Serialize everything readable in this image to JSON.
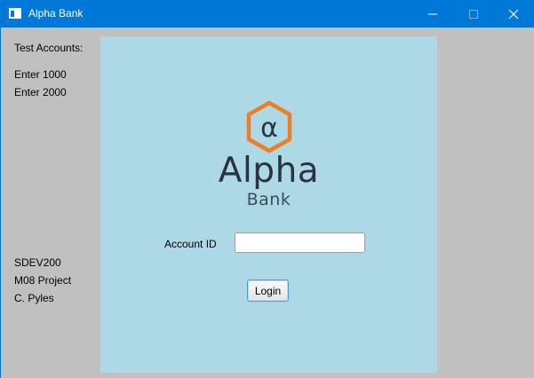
{
  "window": {
    "title": "Alpha Bank"
  },
  "sidebar": {
    "heading": "Test Accounts:",
    "accounts": [
      "Enter 1000",
      "Enter 2000"
    ],
    "credits": [
      "SDEV200",
      "M08 Project",
      "C. Pyles"
    ]
  },
  "logo": {
    "symbol": "α",
    "name": "Alpha",
    "subname": "Bank",
    "colors": {
      "hexagon": "#ef7d22",
      "text": "#2a3342"
    }
  },
  "form": {
    "account_label": "Account ID",
    "account_value": "",
    "login_label": "Login"
  },
  "colors": {
    "titlebar": "#0078d7",
    "panel": "#add8e6",
    "background": "#c0c0c0"
  }
}
